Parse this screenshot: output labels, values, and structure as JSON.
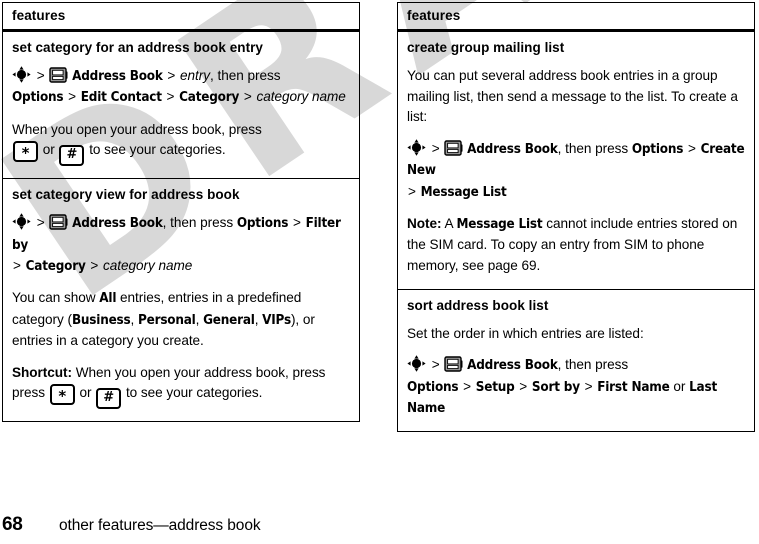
{
  "document": {
    "watermark": "DRAFT",
    "footer": {
      "page_number": "68",
      "running_head": "other features—address book"
    }
  },
  "icons": {
    "nav_key": "navigation-key-icon",
    "address_book": "address-book-icon",
    "star_key": "*",
    "pound_key": "#"
  },
  "left_column": {
    "header": "features",
    "sections": [
      {
        "title": "set category for an address book entry",
        "path_line_1": {
          "menu_1": "Address Book",
          "variable_1": "entry",
          "trailing": ", then press"
        },
        "path_line_2": {
          "menu_1": "Options",
          "menu_2": "Edit Contact",
          "menu_3": "Category",
          "variable_1": "category name"
        },
        "body_1_a": "When you open your address book, press",
        "body_1_b": "or",
        "body_1_c": "to see your categories."
      },
      {
        "title": "set category view for address book",
        "path_line_1": {
          "menu_1": "Address Book",
          "trailing_1": ", then press",
          "menu_2": "Options",
          "menu_3": "Filter by"
        },
        "path_line_2": {
          "menu_1": "Category",
          "variable_1": "category name"
        },
        "body_1_a": "You can show",
        "body_1_b": "All",
        "body_1_c": "entries, entries in a predefined category (",
        "body_1_cat_1": "Business",
        "body_1_cat_2": "Personal",
        "body_1_cat_3": "General",
        "body_1_cat_4": "VIPs",
        "body_1_d": "), or entries in a category you create.",
        "body_2_lead": "Shortcut:",
        "body_2_a": "When you open your address book, press",
        "body_2_b": "or",
        "body_2_c": "to see your categories."
      }
    ]
  },
  "right_column": {
    "header": "features",
    "sections": [
      {
        "title": "create group mailing list",
        "body_1": "You can put several address book entries in a group mailing list, then send a message to the list. To create a list:",
        "path_line_1": {
          "menu_1": "Address Book",
          "trailing_1": ", then press",
          "menu_2": "Options",
          "menu_3": "Create New"
        },
        "path_line_2": {
          "menu_1": "Message List"
        },
        "note_lead": "Note:",
        "note_a": "A",
        "note_menu": "Message List",
        "note_b": "cannot include entries stored on the SIM card. To copy an entry from SIM to phone memory, see page 69."
      },
      {
        "title": "sort address book list",
        "body_1": "Set the order in which entries are listed:",
        "path_line_1": {
          "menu_1": "Address Book",
          "trailing_1": ", then press"
        },
        "path_line_2": {
          "menu_1": "Options",
          "menu_2": "Setup",
          "menu_3": "Sort by",
          "menu_4": "First Name",
          "joiner": "or",
          "menu_5": "Last Name"
        }
      }
    ]
  }
}
